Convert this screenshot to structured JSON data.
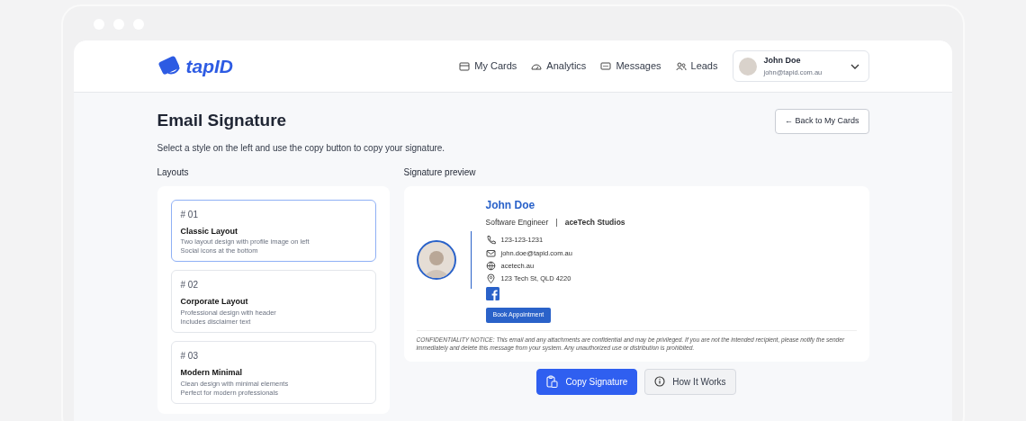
{
  "brand": {
    "name": "tapID"
  },
  "nav": [
    {
      "label": "My Cards"
    },
    {
      "label": "Analytics"
    },
    {
      "label": "Messages"
    },
    {
      "label": "Leads"
    }
  ],
  "user": {
    "name": "John Doe",
    "email": "john@tapid.com.au"
  },
  "page": {
    "title": "Email Signature",
    "subtitle": "Select a style on the left and use the copy button to copy your signature.",
    "back_button": "← Back to My Cards"
  },
  "layouts_heading": "Layouts",
  "layouts": [
    {
      "number": "# 01",
      "title": "Classic Layout",
      "lines": [
        "Two layout design with profile image on left",
        "Social icons at the bottom"
      ],
      "selected": true
    },
    {
      "number": "# 02",
      "title": "Corporate Layout",
      "lines": [
        "Professional design with header",
        "Includes disclaimer text"
      ],
      "selected": false
    },
    {
      "number": "# 03",
      "title": "Modern Minimal",
      "lines": [
        "Clean design with minimal elements",
        "Perfect for modern professionals"
      ],
      "selected": false
    }
  ],
  "preview_heading": "Signature preview",
  "signature": {
    "name": "John Doe",
    "role": "Software Engineer",
    "separator": "|",
    "company": "aceTech Studios",
    "contacts": [
      {
        "kind": "phone",
        "text": "123-123-1231"
      },
      {
        "kind": "email",
        "text": "john.doe@tapid.com.au"
      },
      {
        "kind": "web",
        "text": "acetech.au"
      },
      {
        "kind": "address",
        "text": "123 Tech St, QLD 4220"
      }
    ],
    "cta": "Book Appointment",
    "notice": "CONFIDENTIALITY NOTICE: This email and any attachments are confidential and may be privileged. If you are not the intended recipient, please notify the sender immediately and delete this message from your system. Any unauthorized use or distribution is prohibited."
  },
  "actions": [
    {
      "kind": "primary",
      "label": "Copy Signature"
    },
    {
      "kind": "secondary",
      "label": "How It Works"
    }
  ]
}
